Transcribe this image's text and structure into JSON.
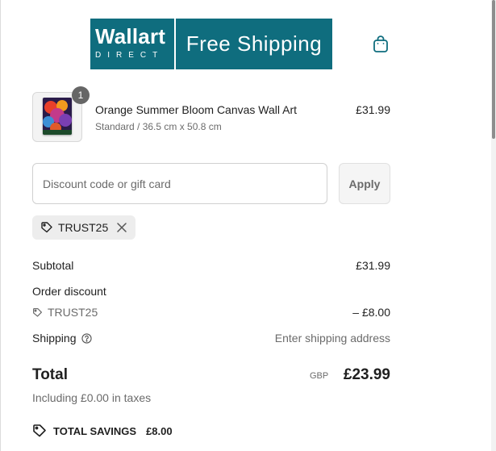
{
  "logo": {
    "brand_top": "Wallart",
    "brand_bottom": "DIRECT",
    "tagline": "Free Shipping",
    "color": "#0f6d7e"
  },
  "header": {
    "cart_icon": "shopping-bag-icon",
    "accent": "#0f6d7e"
  },
  "cart": {
    "items": [
      {
        "quantity": "1",
        "title": "Orange Summer Bloom Canvas Wall Art",
        "variant": "Standard / 36.5 cm x 50.8 cm",
        "price": "£31.99"
      }
    ]
  },
  "discount": {
    "placeholder": "Discount code or gift card",
    "value": "",
    "apply_label": "Apply",
    "applied_code": "TRUST25"
  },
  "summary": {
    "subtotal_label": "Subtotal",
    "subtotal_value": "£31.99",
    "order_discount_label": "Order discount",
    "discount_code": "TRUST25",
    "discount_value": "– £8.00",
    "shipping_label": "Shipping",
    "shipping_value": "Enter shipping address",
    "total_label": "Total",
    "currency": "GBP",
    "total_value": "£23.99",
    "taxes_note": "Including £0.00 in taxes",
    "savings_label": "TOTAL SAVINGS",
    "savings_value": "£8.00"
  }
}
